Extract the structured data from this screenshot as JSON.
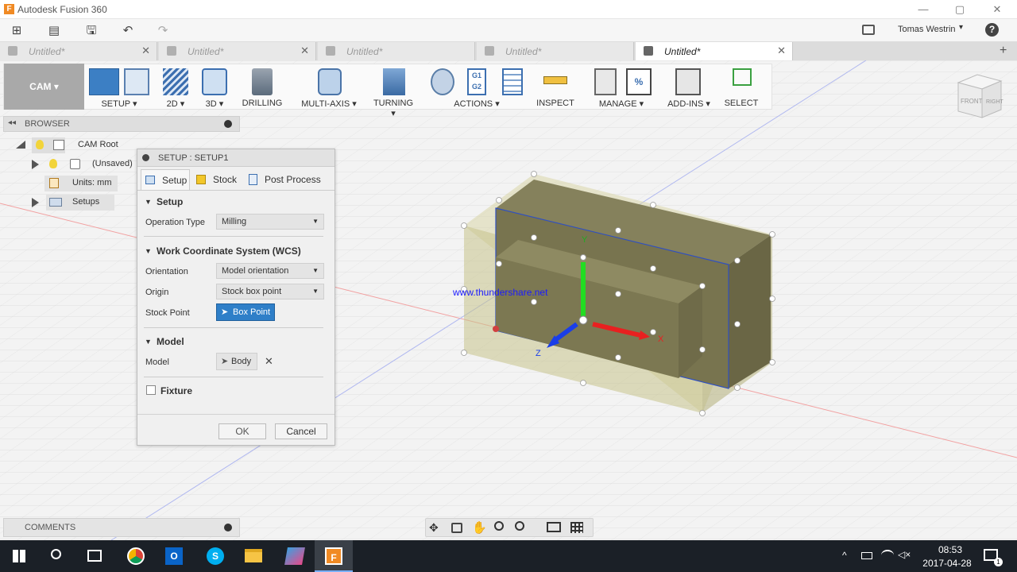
{
  "app": {
    "title": "Autodesk Fusion 360",
    "logo_letter": "F",
    "user": "Tomas Westrin"
  },
  "window": {
    "minimize": "—",
    "maximize": "▢",
    "close": "✕"
  },
  "quick_access": {
    "grid": "⊞",
    "file": "▤",
    "save": "🖫",
    "undo": "↶",
    "redo": "↷",
    "help": "?"
  },
  "tabs": [
    {
      "label": "Untitled*",
      "active": false
    },
    {
      "label": "Untitled*",
      "active": false
    },
    {
      "label": "Untitled*",
      "active": false
    },
    {
      "label": "Untitled*",
      "active": false
    },
    {
      "label": "Untitled*",
      "active": true
    }
  ],
  "tab_close": "✕",
  "workspace": {
    "label": "CAM ▾"
  },
  "toolbar": [
    {
      "label": "SETUP ▾"
    },
    {
      "label": "2D ▾"
    },
    {
      "label": "3D ▾"
    },
    {
      "label": "DRILLING"
    },
    {
      "label": "MULTI-AXIS ▾"
    },
    {
      "label": "TURNING ▾"
    },
    {
      "label": "ACTIONS ▾"
    },
    {
      "label": "INSPECT"
    },
    {
      "label": "MANAGE ▾"
    },
    {
      "label": "ADD-INS ▾"
    },
    {
      "label": "SELECT"
    }
  ],
  "actions_g": {
    "g1": "G1",
    "g2": "G2"
  },
  "browser": {
    "title": "BROWSER",
    "items": [
      {
        "label": "CAM Root"
      },
      {
        "label": "(Unsaved)"
      },
      {
        "label": "Units: mm"
      },
      {
        "label": "Setups"
      }
    ]
  },
  "dialog": {
    "title": "SETUP : SETUP1",
    "tabs": [
      "Setup",
      "Stock",
      "Post Process"
    ],
    "setup_section": "Setup",
    "operation_type_label": "Operation Type",
    "operation_type_value": "Milling",
    "wcs_section": "Work Coordinate System (WCS)",
    "orientation_label": "Orientation",
    "orientation_value": "Model orientation",
    "origin_label": "Origin",
    "origin_value": "Stock box point",
    "stock_point_label": "Stock Point",
    "stock_point_value": "Box Point",
    "model_section": "Model",
    "model_label": "Model",
    "model_value": "Body",
    "model_clear": "✕",
    "fixture_label": "Fixture",
    "fixture_checked": false,
    "ok": "OK",
    "cancel": "Cancel"
  },
  "comments": {
    "title": "COMMENTS"
  },
  "viewcube": {
    "front": "FRONT",
    "right": "RIGHT"
  },
  "axes": {
    "x": "X",
    "y": "Y",
    "z": "Z"
  },
  "watermark": "www.thundershare.net",
  "taskbar": {
    "time": "08:53",
    "date": "2017-04-28",
    "notifications": "1"
  },
  "colors": {
    "accent": "#0078d7",
    "stock": "#c9c58a",
    "x_axis": "#e82020",
    "y_axis": "#22dd22",
    "z_axis": "#1a3ee8"
  }
}
